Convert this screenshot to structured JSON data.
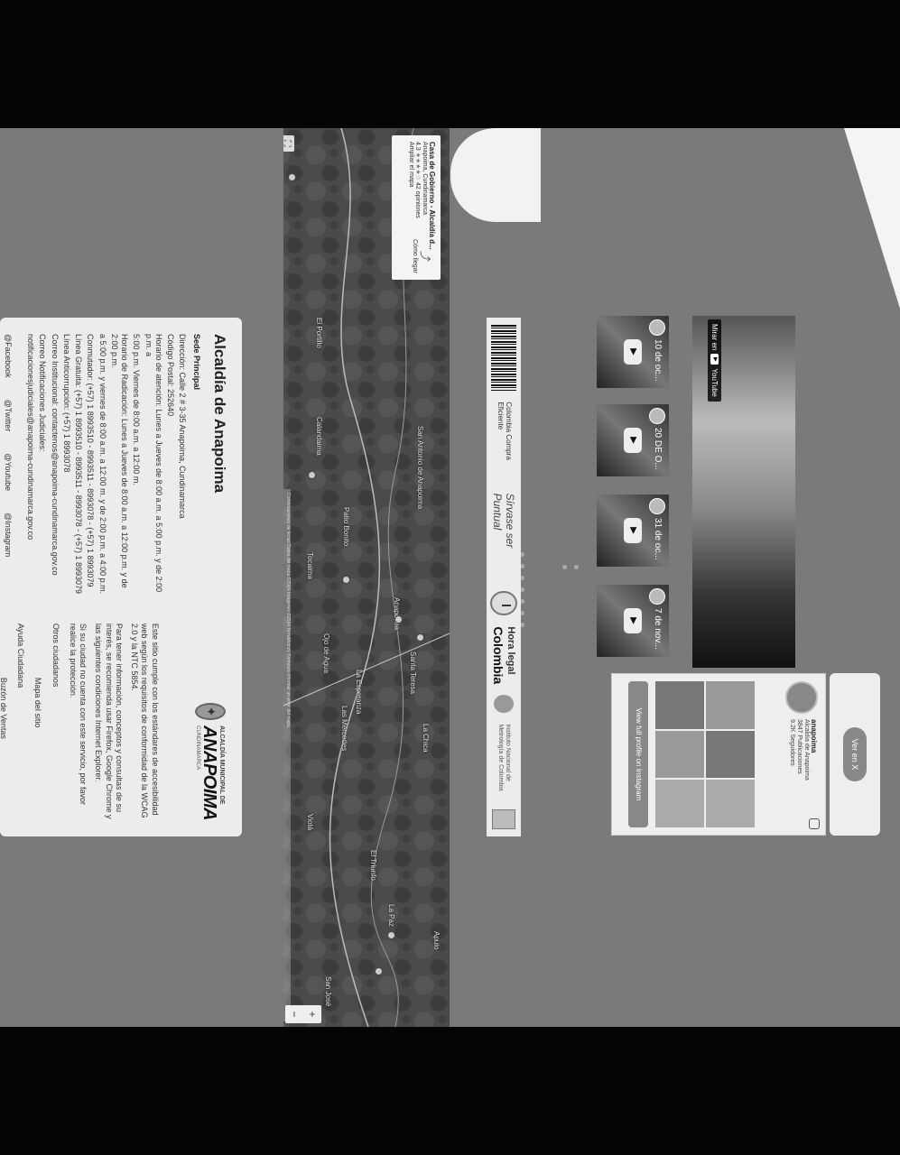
{
  "info_card": {
    "title": "Alcaldía de Anapoima",
    "logo": {
      "top": "ALCALDÍA MUNICIPAL DE",
      "name": "ANAPOIMA",
      "sub": "CUNDINAMARCA"
    },
    "sede_title": "Sede Principal",
    "lines": [
      "Dirección: Calle 2 # 3-35 Anapoima, Cundinamarca",
      "Código Postal: 252640",
      "Horario de atención: Lunes a Jueves de 8:00 a.m. a 5:00 p.m. y de 2:00 p.m. a",
      "5:00 p.m. Viernes de 8:00 a.m. a 12:00 m.",
      "Horario de Radicación: Lunes a Jueves de 8:00 a.m. a 12:00 p.m. y de 2:00 p.m.",
      "a 5:00 p.m. y viernes de 8:00 a.m. a 12:00 m. y de 2:00 p.m. a 4:00 p.m.",
      "Conmutador: (+57) 1 8993510 - 8993511 - 8993078 - (+57) 1 8993079",
      "Línea Gratuita: (+57) 1 8993510 - 8993511 - 8993078 - (+57) 1 8993079",
      "Línea Anticorrupción: (+57) 1 8993078",
      "Correo Institucional: contactenos@anapoima-cundinamarca.gov.co",
      "Correo Notificaciones Judiciales:",
      "notificacionesjudiciales@anapoima-cundinamarca.gov.co"
    ],
    "right_paras": [
      "Este sitio cumple con los estándares de accesibilidad web según los requisitos de conformidad de la WCAG 2.0 y la NTC 5854.",
      "Para tener información, conceptos y consultas de su interés, se recomienda usar Firefox, Google Chrome y las siguientes condiciones Internet Explorer.",
      "Si su ciudad no cuenta con este servicio, por favor realice la protección."
    ],
    "right_links": [
      "Otros ciudadanos",
      "Mapa del sitio",
      "Ayuda Ciudadana",
      "Buzón de Ventas"
    ],
    "social": [
      "@Facebook",
      "@Twitter",
      "@Youtube",
      "@Instagram"
    ]
  },
  "map": {
    "place_title": "Casa de Gobierno - Alcaldía d...",
    "place_address": "Anapoima, Cundinamarca",
    "rating": "4.3",
    "reviews": "42 opiniones",
    "larger_map": "Ampliar el mapa",
    "directions": "Cómo llegar",
    "attribution": "Combinaciones de teclas   Datos del mapa ©2024 Imágenes ©2024 TerraMetrics   Términos   Informar un error del mapa",
    "labels": [
      "El Portillo",
      "San Antonio de Anapoima",
      "Anapoima",
      "La Esperanza",
      "Santa Teresa",
      "La Chica",
      "El Triunfo",
      "Las Mercedes",
      "La Paz",
      "Apulo",
      "Calandaima",
      "Tocaima",
      "Patio Bonito",
      "Ojo de Agua",
      "San José",
      "Viotá"
    ]
  },
  "time_widget": {
    "slogan": "Sírvase ser Puntual",
    "hl_title": "Hora legal",
    "hl_country": "Colombia",
    "source": "Instituto Nacional de Metrología de Colombia",
    "barcode_label": "Colombia Compra Eficiente"
  },
  "videos": [
    {
      "title": "10 de oc..."
    },
    {
      "title": "20 DE O..."
    },
    {
      "title": "31 de oc..."
    },
    {
      "title": "7 de nov..."
    }
  ],
  "main_video": {
    "watch_label": "Mirar en",
    "yt": "YouTube"
  },
  "instagram": {
    "handle": "anapoima",
    "name": "Alcaldía de Anapoima",
    "posts": "3847 Publicaciones",
    "followers": "9.2K Seguidores",
    "button": "View full profile on Instagram"
  },
  "twitter": {
    "button": "Ver en X"
  }
}
